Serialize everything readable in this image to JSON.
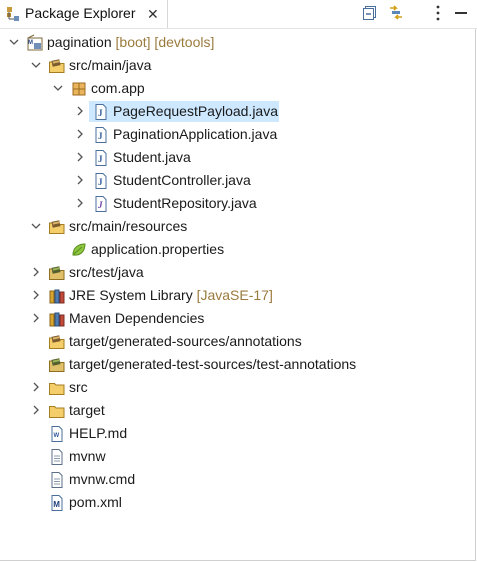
{
  "view": {
    "tab_title": "Package Explorer",
    "tab_close": "✕"
  },
  "tree": [
    {
      "label": "pagination",
      "decoration": " [boot] [devtools]",
      "icon": "maven-project-icon",
      "twistie": "expanded"
    },
    {
      "label": "src/main/java",
      "icon": "source-folder-icon",
      "twistie": "expanded"
    },
    {
      "label": "com.app",
      "icon": "package-icon",
      "twistie": "expanded"
    },
    {
      "label": "PageRequestPayload.java",
      "icon": "java-file-icon",
      "twistie": "collapsed",
      "selected": true
    },
    {
      "label": "PaginationApplication.java",
      "icon": "java-file-icon",
      "twistie": "collapsed"
    },
    {
      "label": "Student.java",
      "icon": "java-file-icon",
      "twistie": "collapsed"
    },
    {
      "label": "StudentController.java",
      "icon": "java-file-icon",
      "twistie": "collapsed"
    },
    {
      "label": "StudentRepository.java",
      "icon": "java-interface-file-icon",
      "twistie": "collapsed"
    },
    {
      "label": "src/main/resources",
      "icon": "source-folder-icon",
      "twistie": "expanded"
    },
    {
      "label": "application.properties",
      "icon": "spring-properties-icon",
      "twistie": "none"
    },
    {
      "label": "src/test/java",
      "icon": "test-source-folder-icon",
      "twistie": "collapsed"
    },
    {
      "label": "JRE System Library",
      "decoration": " [JavaSE-17]",
      "icon": "library-icon",
      "twistie": "collapsed"
    },
    {
      "label": "Maven Dependencies",
      "icon": "library-icon",
      "twistie": "collapsed"
    },
    {
      "label": "target/generated-sources/annotations",
      "icon": "source-folder-icon",
      "twistie": "none"
    },
    {
      "label": "target/generated-test-sources/test-annotations",
      "icon": "test-source-folder-icon",
      "twistie": "none"
    },
    {
      "label": "src",
      "icon": "folder-icon",
      "twistie": "collapsed"
    },
    {
      "label": "target",
      "icon": "folder-icon",
      "twistie": "collapsed"
    },
    {
      "label": "HELP.md",
      "icon": "markdown-file-icon",
      "twistie": "none"
    },
    {
      "label": "mvnw",
      "icon": "text-file-icon",
      "twistie": "none"
    },
    {
      "label": "mvnw.cmd",
      "icon": "text-file-icon",
      "twistie": "none"
    },
    {
      "label": "pom.xml",
      "icon": "maven-pom-icon",
      "twistie": "none"
    }
  ]
}
